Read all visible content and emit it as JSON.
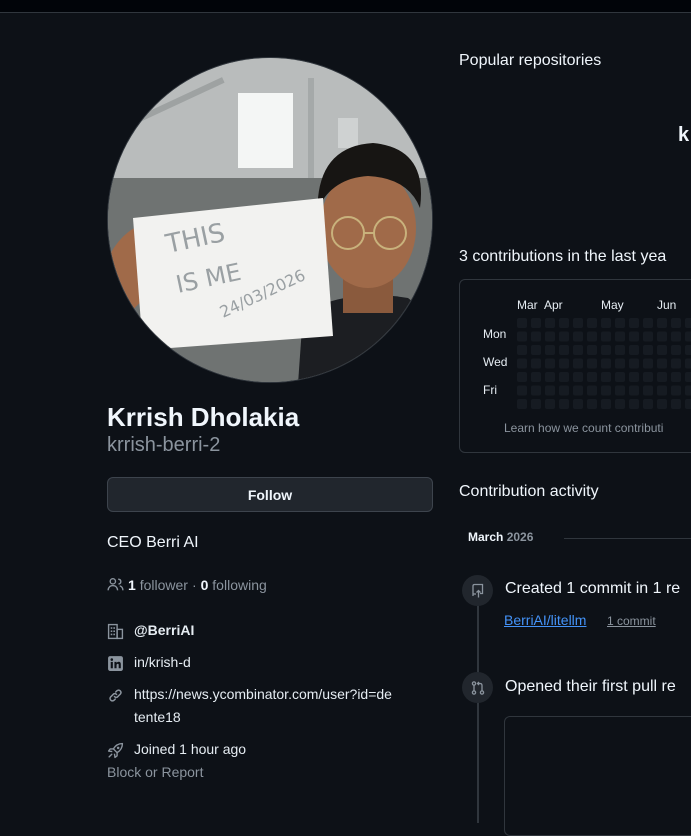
{
  "profile": {
    "name": "Krrish Dholakia",
    "login": "krrish-berri-2",
    "follow_label": "Follow",
    "bio": "CEO Berri AI",
    "followers_count": "1",
    "followers_label": "follower",
    "separator": "·",
    "following_count": "0",
    "following_label": "following",
    "org": "@BerriAI",
    "linkedin": "in/krish-d",
    "website_line1": "https://news.ycombinator.com/user?id=de",
    "website_line2": "tente18",
    "joined": "Joined 1 hour ago",
    "block_report": "Block or Report",
    "avatar_sign_text": [
      "THIS",
      "IS ME",
      "24/03/2026"
    ]
  },
  "popular": {
    "title": "Popular repositories",
    "pinned_partial": "k"
  },
  "contributions": {
    "title": "3 contributions in the last yea",
    "months": [
      "Mar",
      "Apr",
      "May",
      "Jun"
    ],
    "days": [
      "Mon",
      "Wed",
      "Fri"
    ],
    "learn_text": "Learn how we count contributi"
  },
  "activity": {
    "title": "Contribution activity",
    "month": "March",
    "year": "2026",
    "items": [
      {
        "text": "Created 1 commit in 1 re",
        "icon": "repo-push-icon",
        "repo": "BerriAI/litellm",
        "count": "1 commit"
      },
      {
        "text": "Opened their first pull re",
        "icon": "git-pull-request-icon"
      }
    ]
  },
  "colors": {
    "background": "#0d1117",
    "border": "#30363d",
    "link": "#4493f8",
    "muted": "#8b949e"
  }
}
